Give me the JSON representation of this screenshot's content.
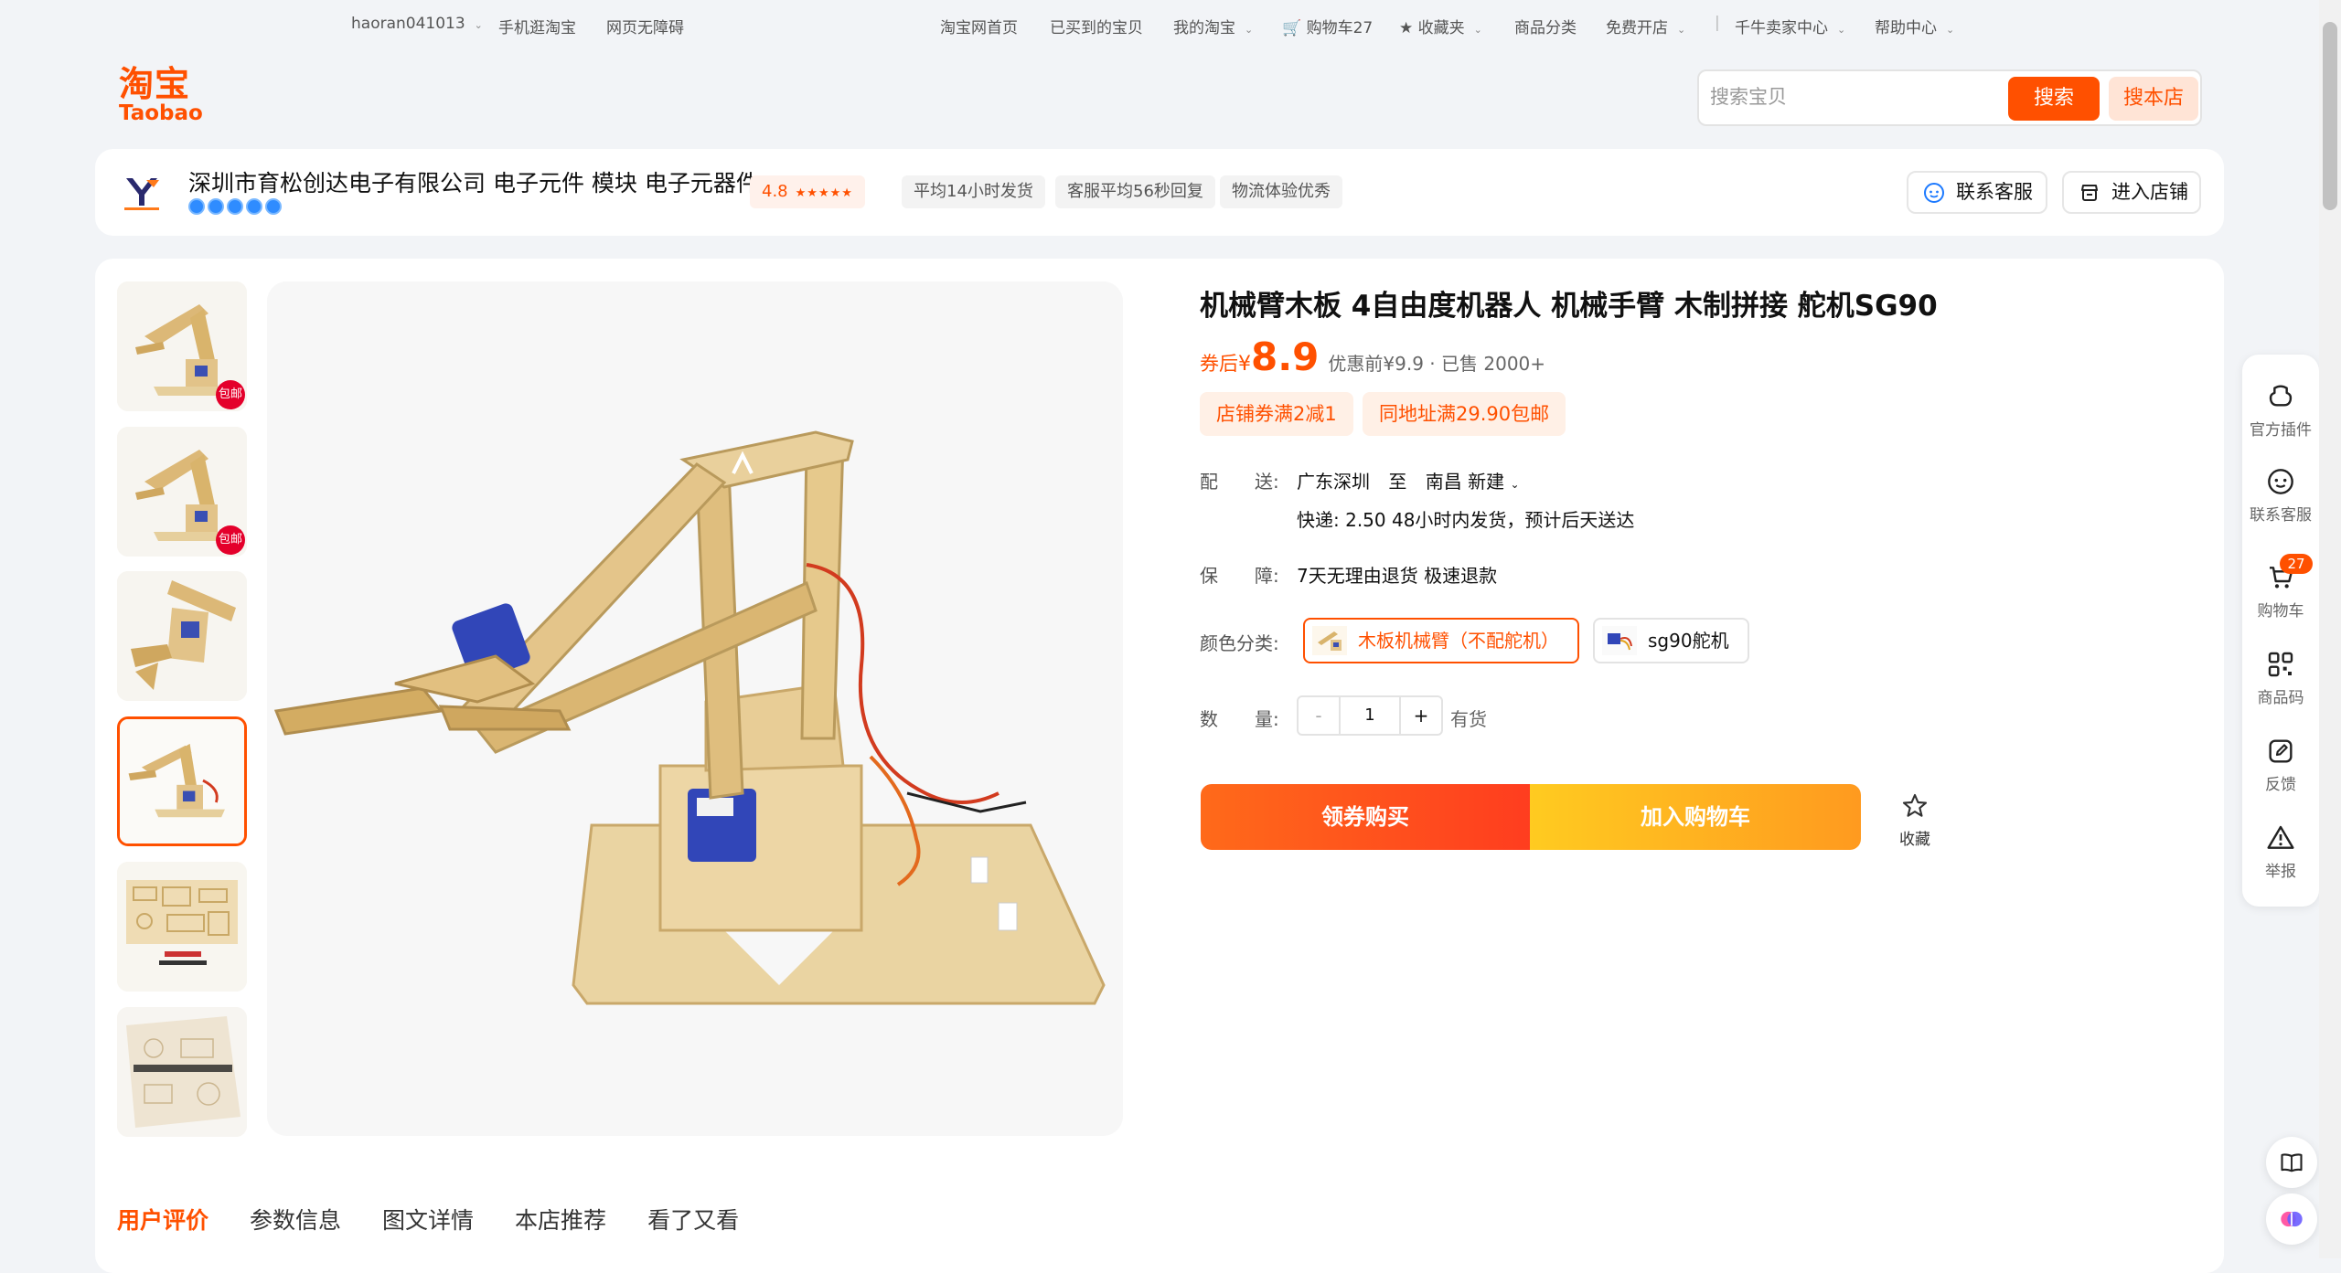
{
  "topnav": {
    "username": "haoran041013",
    "mobile": "手机逛淘宝",
    "accessible": "网页无障碍",
    "home": "淘宝网首页",
    "bought": "已买到的宝贝",
    "my_taobao": "我的淘宝",
    "cart": "购物车27",
    "favorites": "收藏夹",
    "categories": "商品分类",
    "open_shop": "免费开店",
    "seller_center": "千牛卖家中心",
    "help": "帮助中心"
  },
  "logo": {
    "cn": "淘宝",
    "en": "Taobao"
  },
  "search": {
    "placeholder": "搜索宝贝",
    "search_label": "搜索",
    "shop_search_label": "搜本店"
  },
  "shop": {
    "name": "深圳市育松创达电子有限公司 电子元件 模块 电子元器件",
    "rating": "4.8",
    "rating_stars": "★★★★★",
    "ship_time": "平均14小时发货",
    "reply_time": "客服平均56秒回复",
    "logistics": "物流体验优秀",
    "contact_label": "联系客服",
    "enter_label": "进入店铺"
  },
  "product": {
    "title": "机械臂木板 4自由度机器人 机械手臂 木制拼接 舵机SG90",
    "price_label": "券后",
    "currency": "¥",
    "price": "8.9",
    "price_meta": "优惠前¥9.9 · 已售 2000+",
    "coupons": [
      "店铺券满2减1",
      "同地址满29.90包邮"
    ],
    "ship_label": "配　　送:",
    "ship_from": "广东深圳",
    "ship_to_word": "至",
    "ship_to": "南昌 新建",
    "ship_detail": "快递: 2.50   48小时内发货，预计后天送达",
    "guarantee_label": "保　　障:",
    "guarantee": "7天无理由退货 极速退款",
    "color_label": "颜色分类:",
    "sku_options": [
      "木板机械臂（不配舵机）",
      "sg90舵机"
    ],
    "qty_label": "数　　量:",
    "qty_minus": "-",
    "qty_value": "1",
    "qty_plus": "+",
    "stock": "有货",
    "buy_label": "领券购买",
    "cart_label": "加入购物车",
    "fav_label": "收藏"
  },
  "thumb_badge": "包邮",
  "tabs": [
    "用户评价",
    "参数信息",
    "图文详情",
    "本店推荐",
    "看了又看"
  ],
  "right_toolbar": {
    "plugin": "官方插件",
    "service": "联系客服",
    "cart": "购物车",
    "cart_badge": "27",
    "qrcode": "商品码",
    "feedback": "反馈",
    "report": "举报"
  },
  "colors": {
    "accent": "#ff5000",
    "buy_gradient": [
      "#ff6a1a",
      "#ff3d1f"
    ],
    "cart_gradient": [
      "#ffcb20",
      "#ff9a1f"
    ]
  }
}
